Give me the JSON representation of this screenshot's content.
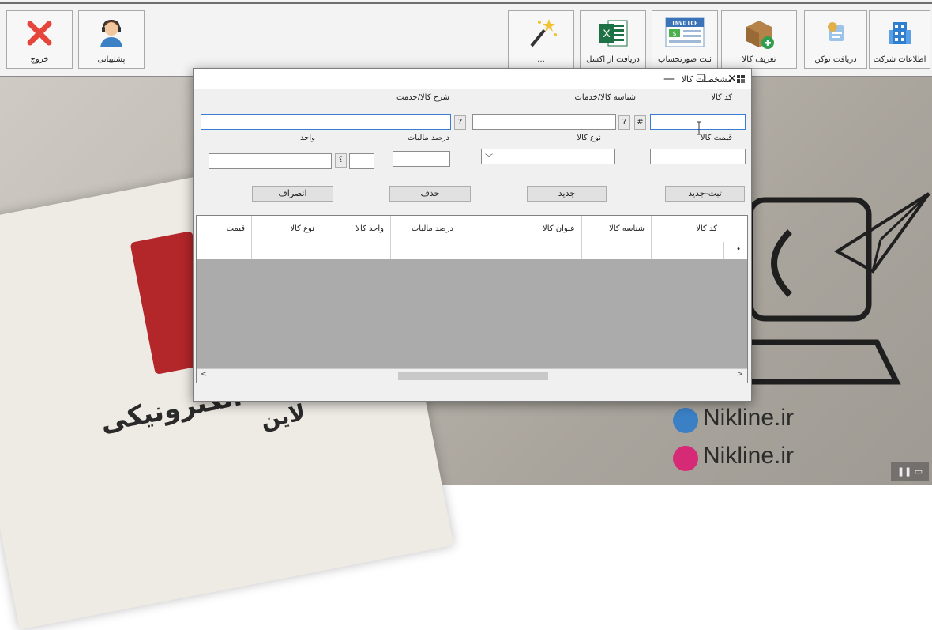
{
  "toolbar": {
    "buttons_right": [
      {
        "label": "اطلاعات شرکت",
        "icon": "building-icon"
      },
      {
        "label": "دریافت توکن",
        "icon": "token-icon"
      },
      {
        "label": "تعریف کالا",
        "icon": "product-add-icon"
      },
      {
        "label": "ثبت صورتحساب",
        "icon": "invoice-icon"
      },
      {
        "label": "دریافت از اکسل",
        "icon": "excel-icon"
      },
      {
        "label": "...",
        "icon": "magic-wand-icon"
      }
    ],
    "buttons_left": [
      {
        "label": "خروج",
        "icon": "close-icon"
      },
      {
        "label": "پشتیبانی",
        "icon": "support-icon"
      }
    ],
    "invoice_icon_text": "INVOICE"
  },
  "dialog": {
    "title": "مشخصات کالا",
    "window_controls": {
      "minimize": "—",
      "maximize": "☐",
      "close": "✕"
    },
    "labels": {
      "code": "کد کالا",
      "identifier": "شناسه کالا/خدمات",
      "description": "شرح کالا/خدمت",
      "price": "قیمت کالا",
      "type": "نوع کالا",
      "tax": "درصد مالیات",
      "unit": "واحد"
    },
    "hash_button": "#",
    "question_button": "?",
    "unit_question_button": "؟",
    "buttons": {
      "save_new": "ثبت-جدید",
      "new": "جدید",
      "delete": "حذف",
      "cancel": "انصراف"
    },
    "grid": {
      "columns": [
        "کد کالا",
        "شناسه کالا",
        "عنوان کالا",
        "درصد مالیات",
        "واحد کالا",
        "نوع کالا",
        "قیمت"
      ],
      "new_row_marker": "•"
    },
    "scroll_left": "<",
    "scroll_right": ">"
  },
  "background": {
    "site_1": "Nikline.ir",
    "site_2": "Nikline.ir",
    "text_1": "الکترونیکی",
    "text_2": "لاین"
  },
  "colors": {
    "accent_red": "#b3262a",
    "excel_green": "#1e7145",
    "instagram": "#d62976"
  }
}
